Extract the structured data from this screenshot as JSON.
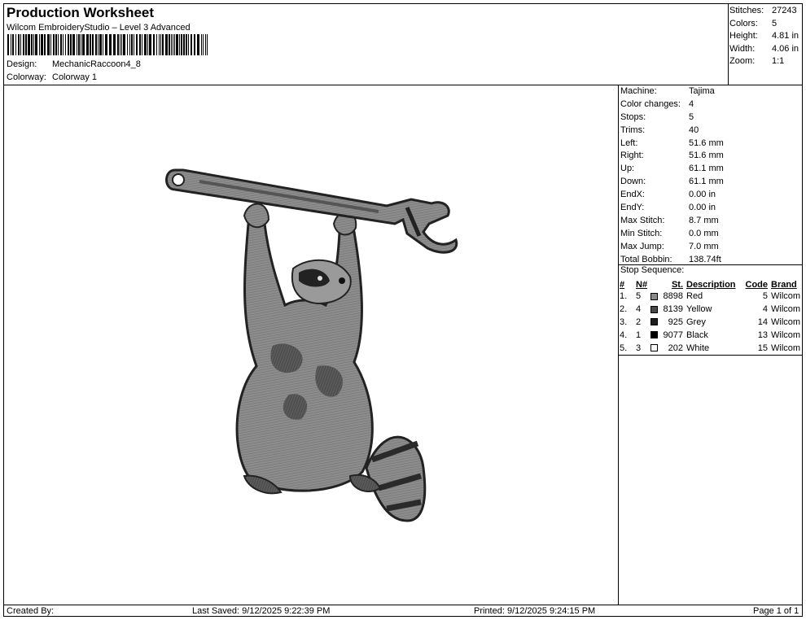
{
  "header": {
    "title": "Production Worksheet",
    "subtitle": "Wilcom EmbroideryStudio – Level 3 Advanced",
    "design_label": "Design:",
    "design_value": "MechanicRaccoon4_8",
    "colorway_label": "Colorway:",
    "colorway_value": "Colorway 1"
  },
  "summary": [
    {
      "label": "Stitches:",
      "value": "27243"
    },
    {
      "label": "Colors:",
      "value": "5"
    },
    {
      "label": "Height:",
      "value": "4.81 in"
    },
    {
      "label": "Width:",
      "value": "4.06 in"
    },
    {
      "label": "Zoom:",
      "value": "1:1"
    }
  ],
  "details": [
    {
      "label": "Machine:",
      "value": "Tajima"
    },
    {
      "label": "Color changes:",
      "value": "4"
    },
    {
      "label": "Stops:",
      "value": "5"
    },
    {
      "label": "Trims:",
      "value": "40"
    },
    {
      "label": "Left:",
      "value": "51.6 mm"
    },
    {
      "label": "Right:",
      "value": "51.6 mm"
    },
    {
      "label": "Up:",
      "value": "61.1 mm"
    },
    {
      "label": "Down:",
      "value": "61.1 mm"
    },
    {
      "label": "EndX:",
      "value": "0.00 in"
    },
    {
      "label": "EndY:",
      "value": "0.00 in"
    },
    {
      "label": "Max Stitch:",
      "value": "8.7 mm"
    },
    {
      "label": "Min Stitch:",
      "value": "0.0 mm"
    },
    {
      "label": "Max Jump:",
      "value": "7.0 mm"
    },
    {
      "label": "Total Bobbin:",
      "value": "138.74ft"
    }
  ],
  "stop_sequence": {
    "title": "Stop Sequence:",
    "headers": {
      "num": "#",
      "n": "N#",
      "st": "St.",
      "desc": "Description",
      "code": "Code",
      "brand": "Brand"
    },
    "rows": [
      {
        "idx": "1.",
        "n": "5",
        "color": "#8a8a8a",
        "st": "8898",
        "desc": "Red",
        "code": "5",
        "brand": "Wilcom"
      },
      {
        "idx": "2.",
        "n": "4",
        "color": "#4a4a4a",
        "st": "8139",
        "desc": "Yellow",
        "code": "4",
        "brand": "Wilcom"
      },
      {
        "idx": "3.",
        "n": "2",
        "color": "#1e1e1e",
        "st": "925",
        "desc": "Grey",
        "code": "14",
        "brand": "Wilcom"
      },
      {
        "idx": "4.",
        "n": "1",
        "color": "#000000",
        "st": "9077",
        "desc": "Black",
        "code": "13",
        "brand": "Wilcom"
      },
      {
        "idx": "5.",
        "n": "3",
        "color": "#ffffff",
        "st": "202",
        "desc": "White",
        "code": "15",
        "brand": "Wilcom"
      }
    ]
  },
  "footer": {
    "created": "Created By:",
    "saved": "Last Saved: 9/12/2025 9:22:39 PM",
    "printed": "Printed: 9/12/2025 9:24:15 PM",
    "page": "Page 1 of 1"
  },
  "design_image": {
    "subject": "raccoon hanging from wrench embroidery",
    "colors": [
      "#8a8a8a",
      "#4a4a4a",
      "#1e1e1e",
      "#000000",
      "#ffffff"
    ]
  }
}
